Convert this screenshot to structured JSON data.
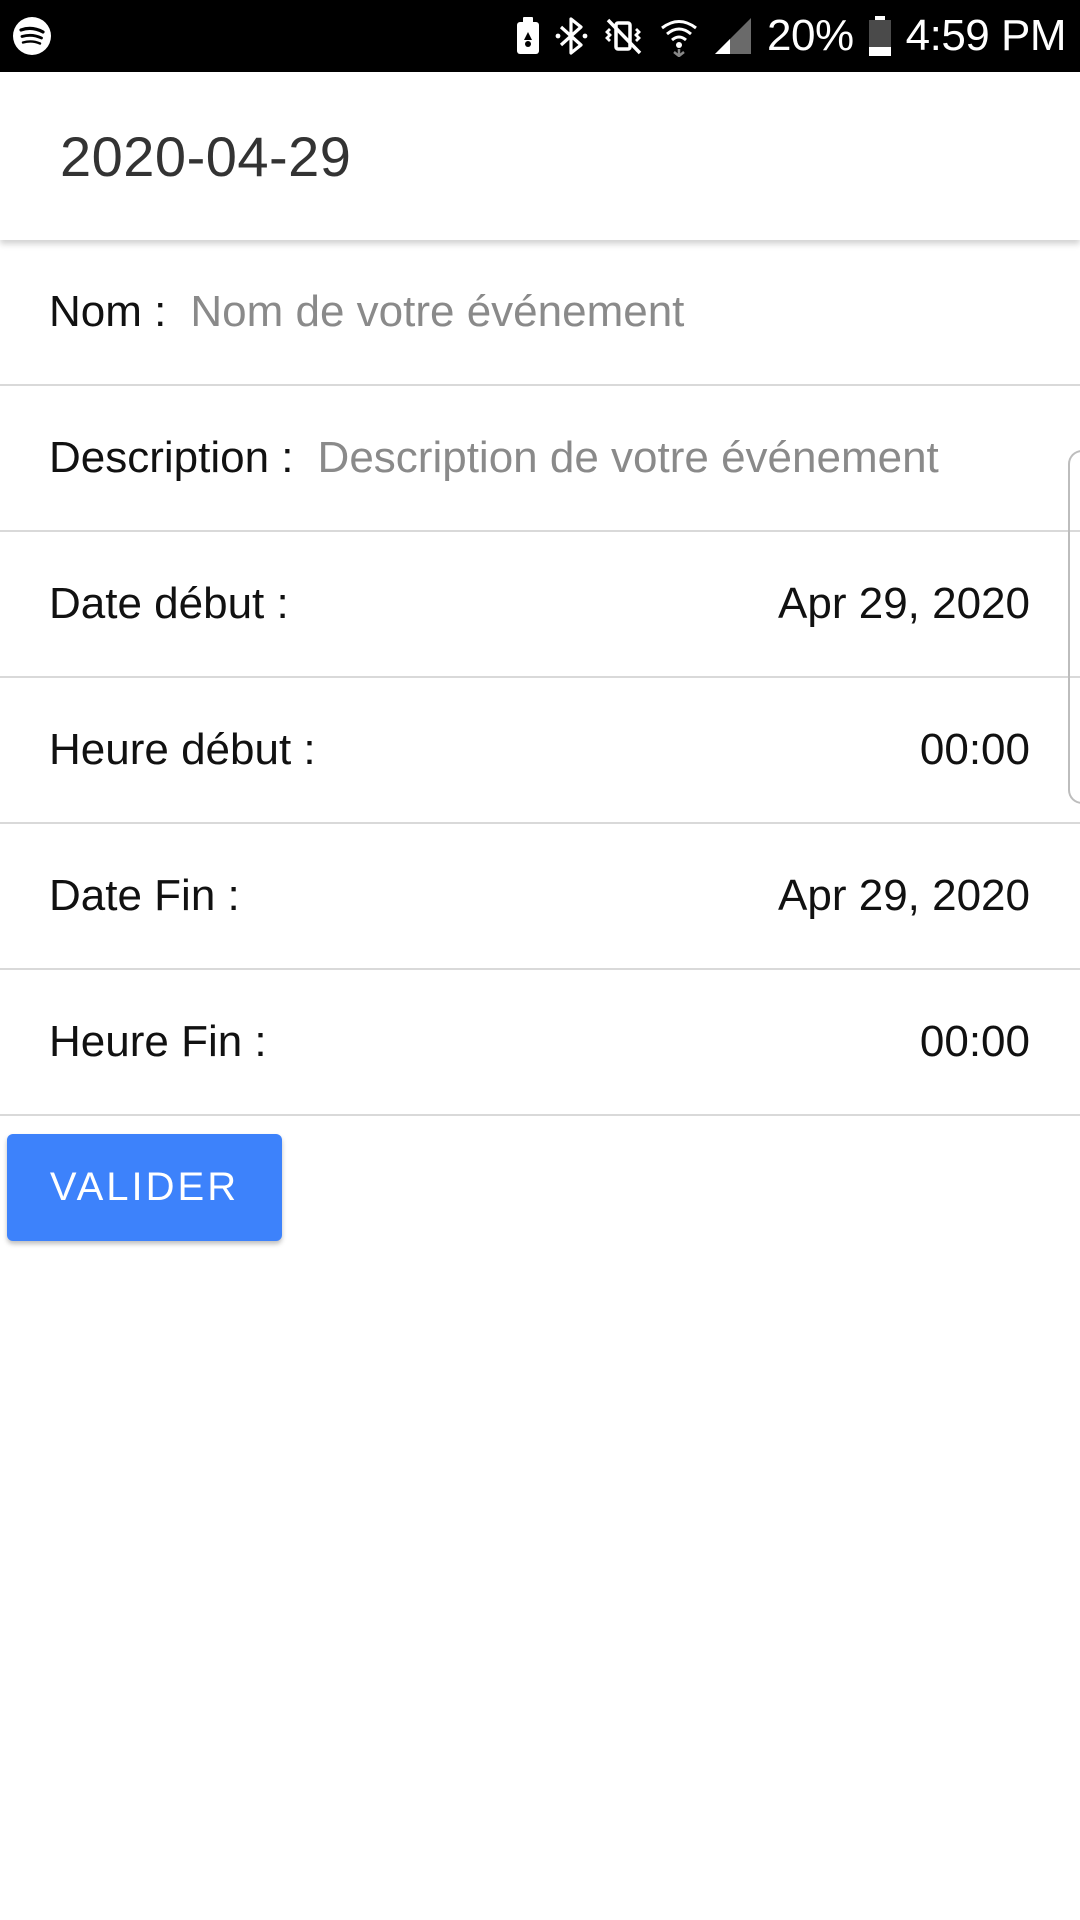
{
  "status_bar": {
    "battery_percent": "20%",
    "time": "4:59 PM",
    "left_icons": [
      "spotify-icon"
    ],
    "right_icons": [
      "battery-saver-icon",
      "bluetooth-icon",
      "vibrate-mute-icon",
      "wifi-icon",
      "cellular-signal-icon",
      "battery-icon"
    ]
  },
  "header": {
    "title": "2020-04-29"
  },
  "form": {
    "name": {
      "label": "Nom :",
      "placeholder": "Nom de votre événement",
      "value": ""
    },
    "description": {
      "label": "Description :",
      "placeholder": "Description de votre événement",
      "value": ""
    },
    "start_date": {
      "label": "Date début :",
      "value": "Apr 29, 2020"
    },
    "start_time": {
      "label": "Heure début :",
      "value": "00:00"
    },
    "end_date": {
      "label": "Date Fin :",
      "value": "Apr 29, 2020"
    },
    "end_time": {
      "label": "Heure Fin :",
      "value": "00:00"
    }
  },
  "actions": {
    "submit_label": "VALIDER"
  },
  "colors": {
    "status_bar_bg": "#000000",
    "button_bg": "#3d82fb",
    "placeholder_text": "#8a8a8a",
    "divider": "#d9d9d9"
  }
}
